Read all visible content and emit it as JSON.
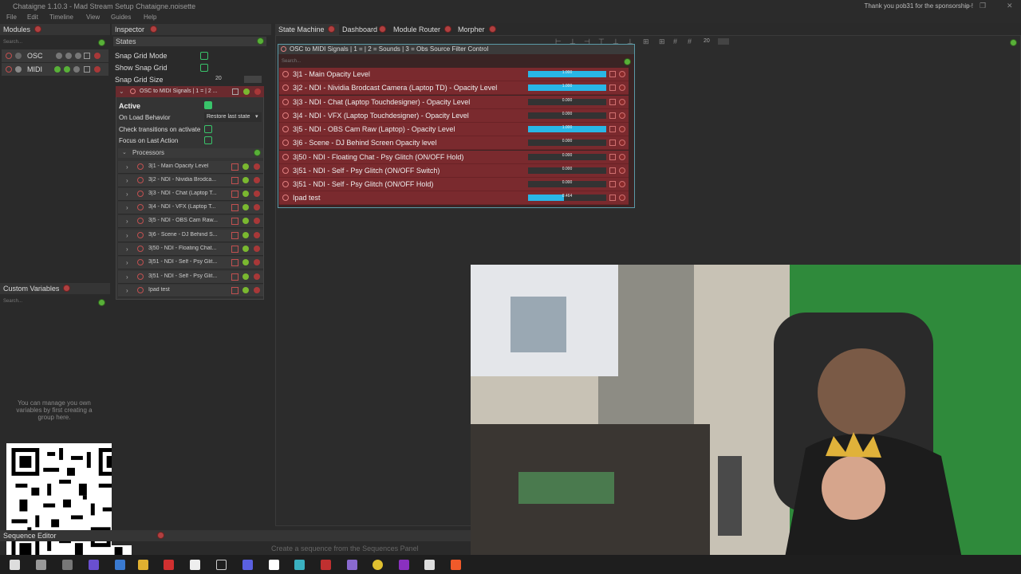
{
  "window": {
    "title": "Chataigne 1.10.3 - Mad Stream Setup Chataigne.noisette",
    "sponsor_text": "Thank you pob31 for the sponsorship !",
    "minimize": "—",
    "restore": "❐",
    "close": "✕"
  },
  "menu": [
    "File",
    "Edit",
    "Timeline",
    "View",
    "Guides",
    "Help"
  ],
  "modules": {
    "title": "Modules",
    "search_placeholder": "Search...",
    "items": [
      {
        "label": "OSC"
      },
      {
        "label": "MIDI"
      }
    ]
  },
  "custom_variables": {
    "title": "Custom Variables",
    "search_placeholder": "Search...",
    "hint": "You can manage you own variables by first creating a group here."
  },
  "inspector": {
    "title": "Inspector",
    "states_label": "States",
    "snap_grid_mode": "Snap Grid Mode",
    "show_snap_grid": "Show Snap Grid",
    "snap_grid_size": "Snap Grid Size",
    "snap_grid_size_value": "20",
    "state_name": "OSC to MIDI Signals | 1 = | 2 ...",
    "active": "Active",
    "on_load_behavior": "On Load Behavior",
    "on_load_value": "Restore last state",
    "check_transitions": "Check transitions on activate",
    "focus_on_last_action": "Focus on Last Action",
    "processors_label": "Processors",
    "processors": [
      "3|1 - Main Opacity Level",
      "3|2 - NDI - Nividia Brodca...",
      "3|3 - NDI - Chat (Laptop T...",
      "3|4 - NDI - VFX (Laptop T...",
      "3|5 - NDI - OBS Cam Raw...",
      "3|6 - Scene - DJ Behind S...",
      "3|50 - NDI - Floating Chat...",
      "3|51 - NDI - Self - Psy Glit...",
      "3|51 - NDI - Self - Psy Glit...",
      "Ipad test"
    ]
  },
  "tabs": [
    {
      "label": "State Machine"
    },
    {
      "label": "Dashboard"
    },
    {
      "label": "Module Router"
    },
    {
      "label": "Morpher"
    }
  ],
  "state_machine": {
    "zoom_value": "20",
    "state_title": "OSC to MIDI Signals | 1 =  | 2 = Sounds | 3 = Obs Source Filter Control",
    "search_placeholder": "Search...",
    "rows": [
      {
        "label": "3|1 - Main Opacity Level",
        "value": "1.000",
        "fill": 1.0
      },
      {
        "label": "3|2 - NDI - Nividia Brodcast Camera (Laptop TD) - Opacity Level",
        "value": "1.000",
        "fill": 1.0
      },
      {
        "label": "3|3 - NDI - Chat (Laptop Touchdesigner) - Opacity Level",
        "value": "0.000",
        "fill": 0
      },
      {
        "label": "3|4 - NDI - VFX (Laptop Touchdesigner) - Opacity Level",
        "value": "0.000",
        "fill": 0
      },
      {
        "label": "3|5 - NDI - OBS Cam Raw (Laptop) - Opacity Level",
        "value": "1.000",
        "fill": 1.0
      },
      {
        "label": "3|6 - Scene - DJ Behind Screen Opacity level",
        "value": "0.000",
        "fill": 0
      },
      {
        "label": "3|50 - NDI - Floating Chat - Psy Glitch (ON/OFF Hold)",
        "value": "0.000",
        "fill": 0
      },
      {
        "label": "3|51 - NDI - Self - Psy Glitch (ON/OFF Switch)",
        "value": "0.000",
        "fill": 0
      },
      {
        "label": "3|51 - NDI - Self - Psy Glitch (ON/OFF Hold)",
        "value": "0.000",
        "fill": 0
      },
      {
        "label": "Ipad test",
        "value": "0.464",
        "fill": 0.464
      }
    ]
  },
  "sequence_editor": {
    "title": "Sequence Editor",
    "hint": "Create a sequence from the Sequences Panel"
  },
  "taskbar_icons": [
    "start-icon",
    "search-icon",
    "task-view-icon",
    "file-explorer-icon",
    "app-icon",
    "app-icon",
    "x-icon",
    "app-icon",
    "bold-b-icon",
    "app-icon",
    "app-icon",
    "app-icon",
    "chrome-icon",
    "app-icon",
    "app-icon",
    "brave-icon"
  ],
  "colors": {
    "accent": "#29b6e6",
    "state_bg": "#7a2a2e",
    "close": "#b04040",
    "add": "#58b038"
  }
}
